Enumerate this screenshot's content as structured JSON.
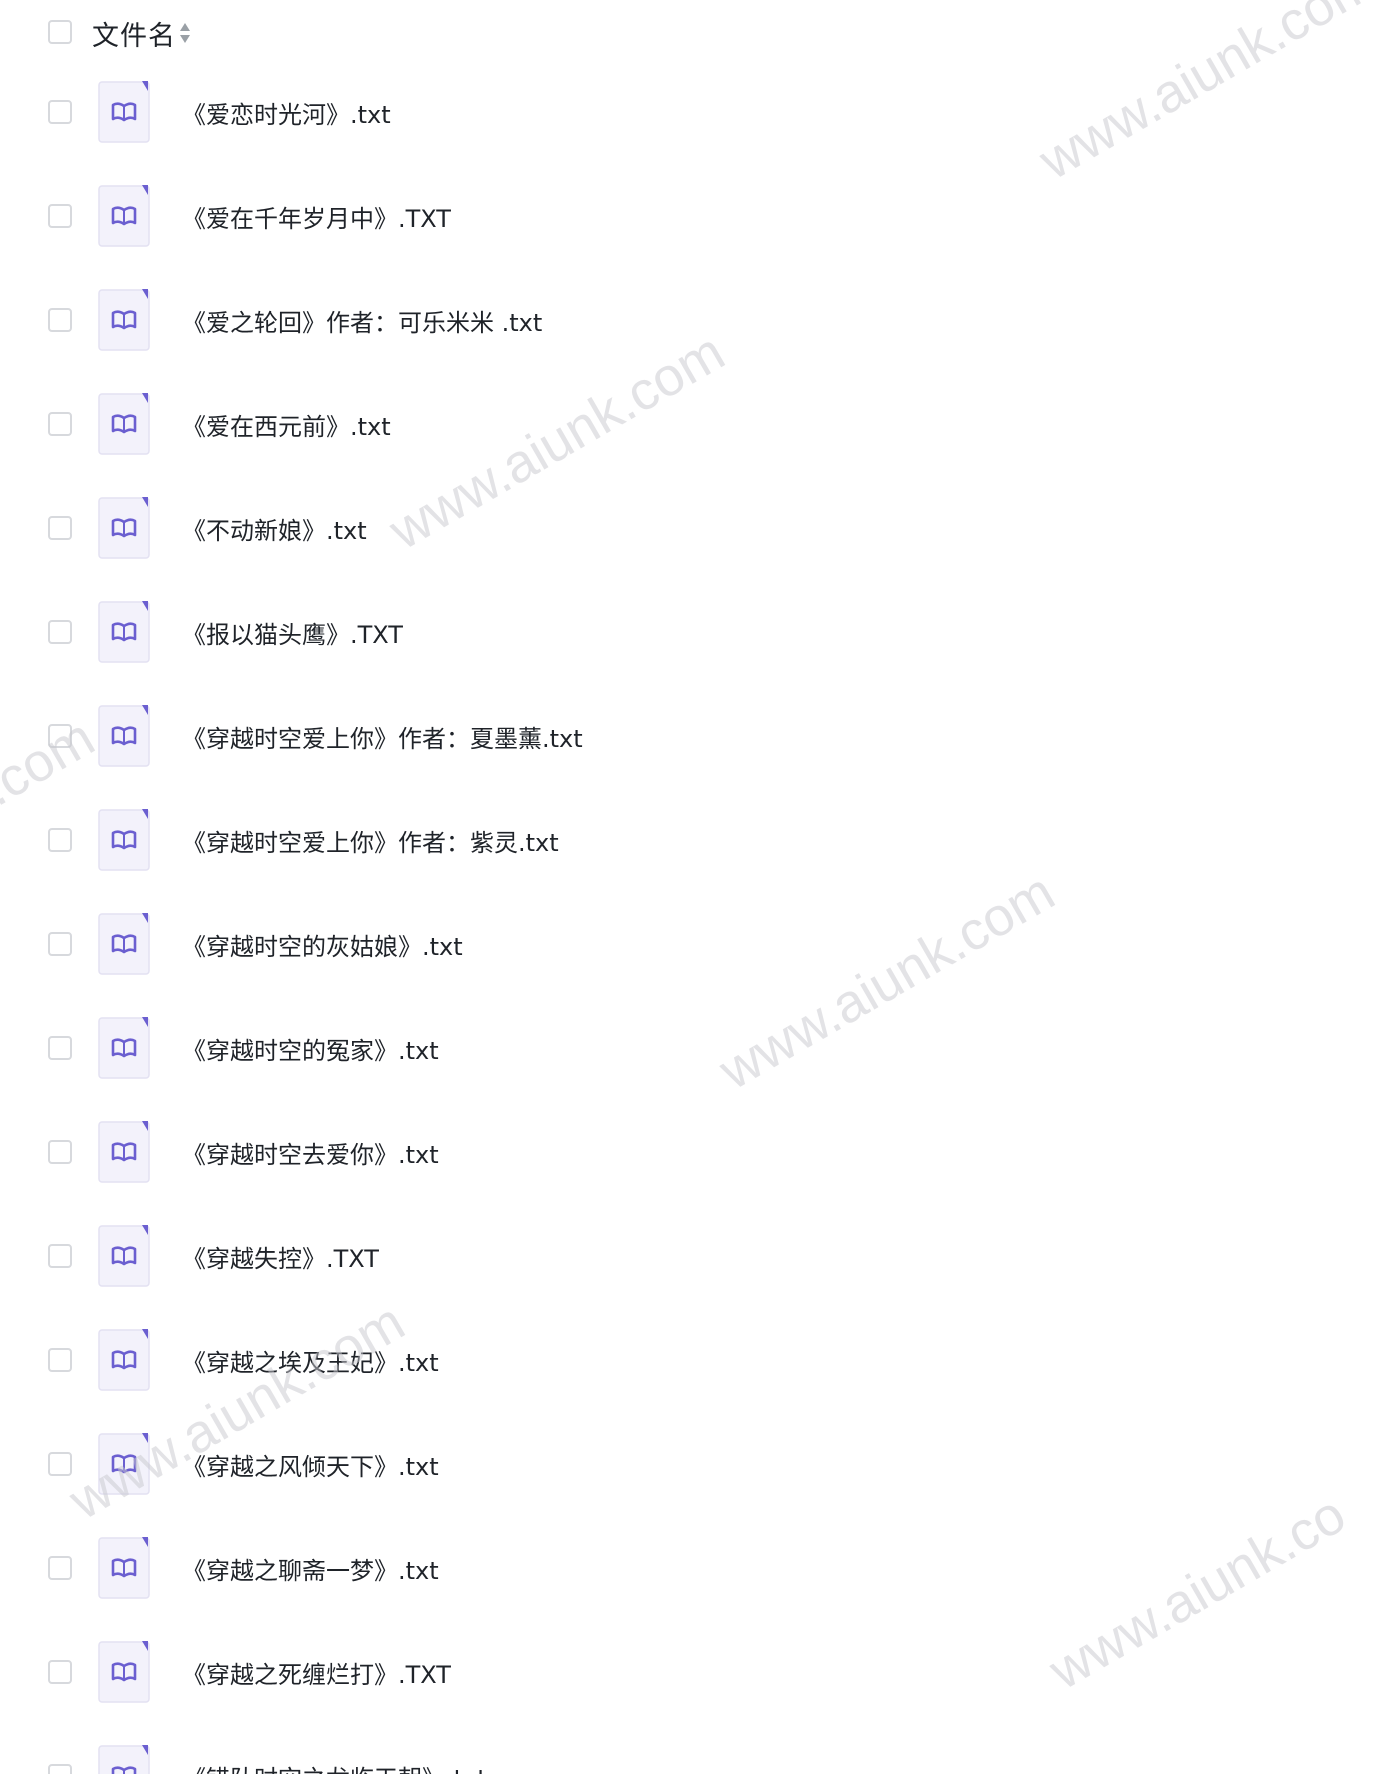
{
  "header": {
    "label": "文件名",
    "sort_icon": "sort-icon"
  },
  "files": [
    {
      "name": "《爱恋时光河》.txt",
      "icon": "book-icon"
    },
    {
      "name": "《爱在千年岁月中》.TXT",
      "icon": "book-icon"
    },
    {
      "name": "《爱之轮回》作者：可乐米米 .txt",
      "icon": "book-icon"
    },
    {
      "name": "《爱在西元前》.txt",
      "icon": "book-icon"
    },
    {
      "name": "《不动新娘》.txt",
      "icon": "book-icon"
    },
    {
      "name": "《报以猫头鹰》.TXT",
      "icon": "book-icon"
    },
    {
      "name": "《穿越时空爱上你》作者：夏墨薰.txt",
      "icon": "book-icon"
    },
    {
      "name": "《穿越时空爱上你》作者：紫灵.txt",
      "icon": "book-icon"
    },
    {
      "name": "《穿越时空的灰姑娘》.txt",
      "icon": "book-icon"
    },
    {
      "name": "《穿越时空的冤家》.txt",
      "icon": "book-icon"
    },
    {
      "name": "《穿越时空去爱你》.txt",
      "icon": "book-icon"
    },
    {
      "name": "《穿越失控》.TXT",
      "icon": "book-icon"
    },
    {
      "name": "《穿越之埃及王妃》.txt",
      "icon": "book-icon"
    },
    {
      "name": "《穿越之风倾天下》.txt",
      "icon": "book-icon"
    },
    {
      "name": "《穿越之聊斋一梦》.txt",
      "icon": "book-icon"
    },
    {
      "name": "《穿越之死缠烂打》.TXT",
      "icon": "book-icon"
    },
    {
      "name": "《错队时空之龙临天朝》.txt",
      "icon": "book-icon"
    }
  ],
  "watermarks": [
    "www.aiunk.com",
    "www.aiunk.com",
    "www.aiunk.com",
    "k.com",
    "www.aiunk.com",
    "www.aiunk.co"
  ],
  "colors": {
    "icon_accent": "#6b5fd0",
    "icon_bg": "#f3f2fb",
    "checkbox_border": "#d7d9dd",
    "text": "#1f2329"
  }
}
